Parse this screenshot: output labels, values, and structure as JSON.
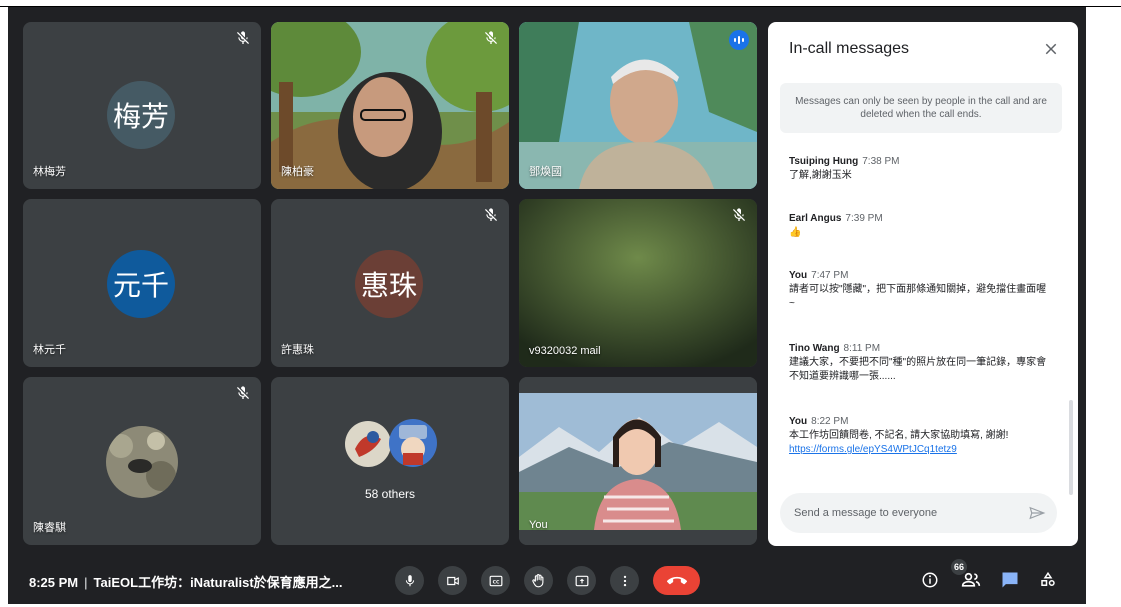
{
  "participants": [
    {
      "name": "林梅芳",
      "initials": "梅芳",
      "color": "#455a64",
      "muted": true
    },
    {
      "name": "陳柏豪",
      "muted": true
    },
    {
      "name": "鄧煥國",
      "speaking": true
    },
    {
      "name": "林元千",
      "initials": "元千",
      "color": "#0f5a9c",
      "muted": false
    },
    {
      "name": "許惠珠",
      "initials": "惠珠",
      "color": "#6b3f36",
      "muted": true
    },
    {
      "name": "v9320032 mail",
      "muted": true
    },
    {
      "name": "陳睿騏",
      "muted": true
    },
    {
      "name": "You",
      "muted": false
    }
  ],
  "others": {
    "label": "58 others"
  },
  "chat": {
    "title": "In-call messages",
    "note": "Messages can only be seen by people in the call and are deleted when the call ends.",
    "messages": [
      {
        "sender": "Tsuiping Hung",
        "time": "7:38 PM",
        "text": "了解,謝謝玉米"
      },
      {
        "sender": "Earl Angus",
        "time": "7:39 PM",
        "text": "👍"
      },
      {
        "sender": "You",
        "time": "7:47 PM",
        "text": "請者可以按\"隱藏\"，把下面那條通知關掉，避免擋住畫面喔~"
      },
      {
        "sender": "Tino Wang",
        "time": "8:11 PM",
        "text": "建議大家，不要把不同\"種\"的照片放在同一筆記錄，專家會不知道要辨識哪一張......"
      },
      {
        "sender": "You",
        "time": "8:22 PM",
        "text": "本工作坊回饋問卷, 不記名, 請大家協助填寫, 謝謝!",
        "link": "https://forms.gle/epYS4WPtJCq1tetz9"
      }
    ],
    "input_placeholder": "Send a message to everyone"
  },
  "bar": {
    "time": "8:25 PM",
    "separator": "|",
    "meeting_title": "TaiEOL工作坊：iNaturalist於保育應用之...",
    "people_count": "66"
  },
  "colors": {
    "background": "#202124",
    "tile": "#3c4043",
    "hangup": "#ea4335",
    "accent": "#8ab4f8",
    "speaking": "#1a73e8"
  },
  "icons": [
    "mic-muted-icon",
    "mic-icon",
    "camera-icon",
    "captions-icon",
    "raise-hand-icon",
    "present-icon",
    "more-icon",
    "hangup-icon",
    "info-icon",
    "people-icon",
    "chat-icon",
    "activities-icon",
    "close-icon",
    "send-icon"
  ]
}
